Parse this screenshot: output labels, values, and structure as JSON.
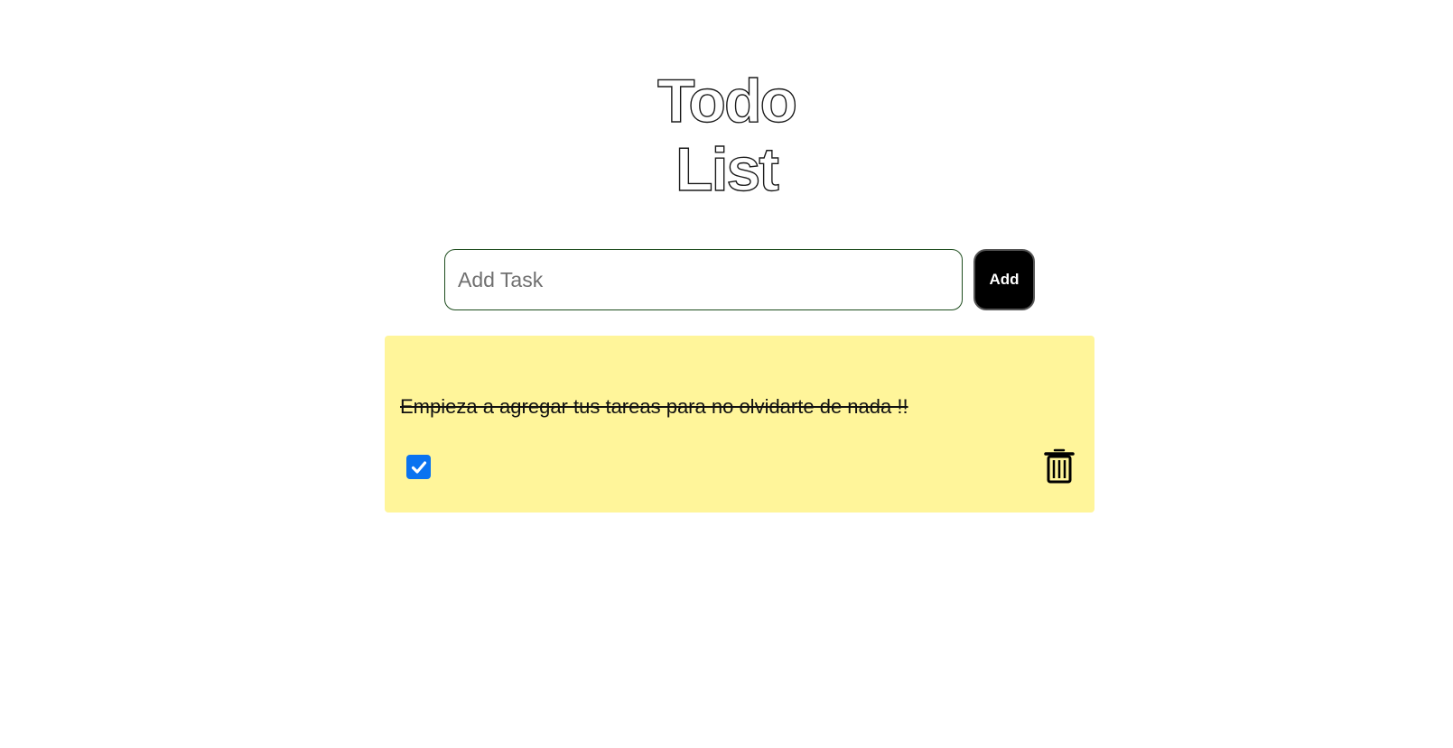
{
  "header": {
    "title_line1": "Todo",
    "title_line2": "List"
  },
  "add_form": {
    "placeholder": "Add Task",
    "value": "",
    "button_label": "Add"
  },
  "tasks": [
    {
      "text": "Empieza a agregar tus tareas para no olvidarte de nada !!",
      "completed": true
    }
  ],
  "colors": {
    "card_background": "#fff59a",
    "checkbox_accent": "#0a73f0",
    "button_background": "#000000"
  },
  "icons": {
    "checkbox": "checkmark-icon",
    "delete": "trash-icon"
  }
}
